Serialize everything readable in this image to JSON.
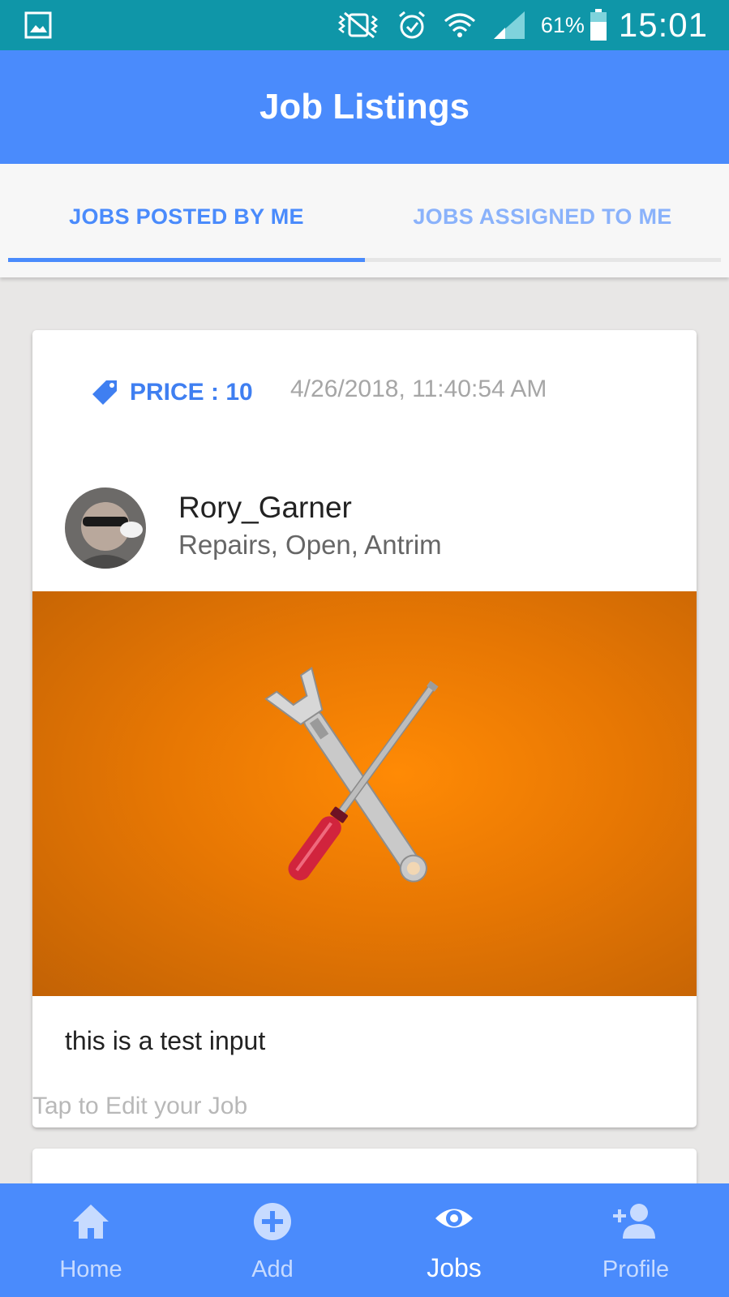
{
  "status_bar": {
    "battery_percent": "61%",
    "time": "15:01",
    "icons": [
      "gallery-notification-icon",
      "vibrate-icon",
      "alarm-icon",
      "wifi-icon",
      "signal-icon",
      "battery-icon"
    ]
  },
  "app_bar": {
    "title": "Job Listings"
  },
  "tabs": [
    {
      "label": "JOBS POSTED BY ME",
      "active": true
    },
    {
      "label": "JOBS ASSIGNED TO ME",
      "active": false
    }
  ],
  "job_card": {
    "price_label": "PRICE : 10",
    "date": "4/26/2018, 11:40:54 AM",
    "poster_name": "Rory_Garner",
    "poster_meta": "Repairs, Open, Antrim",
    "image_icon": "wrench-screwdriver-image",
    "description": "this is a test input",
    "edit_hint": "Tap to Edit your Job"
  },
  "bottom_nav": [
    {
      "label": "Home",
      "icon": "home-icon",
      "active": false
    },
    {
      "label": "Add",
      "icon": "add-circle-icon",
      "active": false
    },
    {
      "label": "Jobs",
      "icon": "eye-icon",
      "active": true
    },
    {
      "label": "Profile",
      "icon": "add-person-icon",
      "active": false
    }
  ],
  "colors": {
    "status_bar": "#0f96a8",
    "primary": "#4a8bfc",
    "price": "#3f7ff1",
    "image_orange": "#ff8a05"
  }
}
